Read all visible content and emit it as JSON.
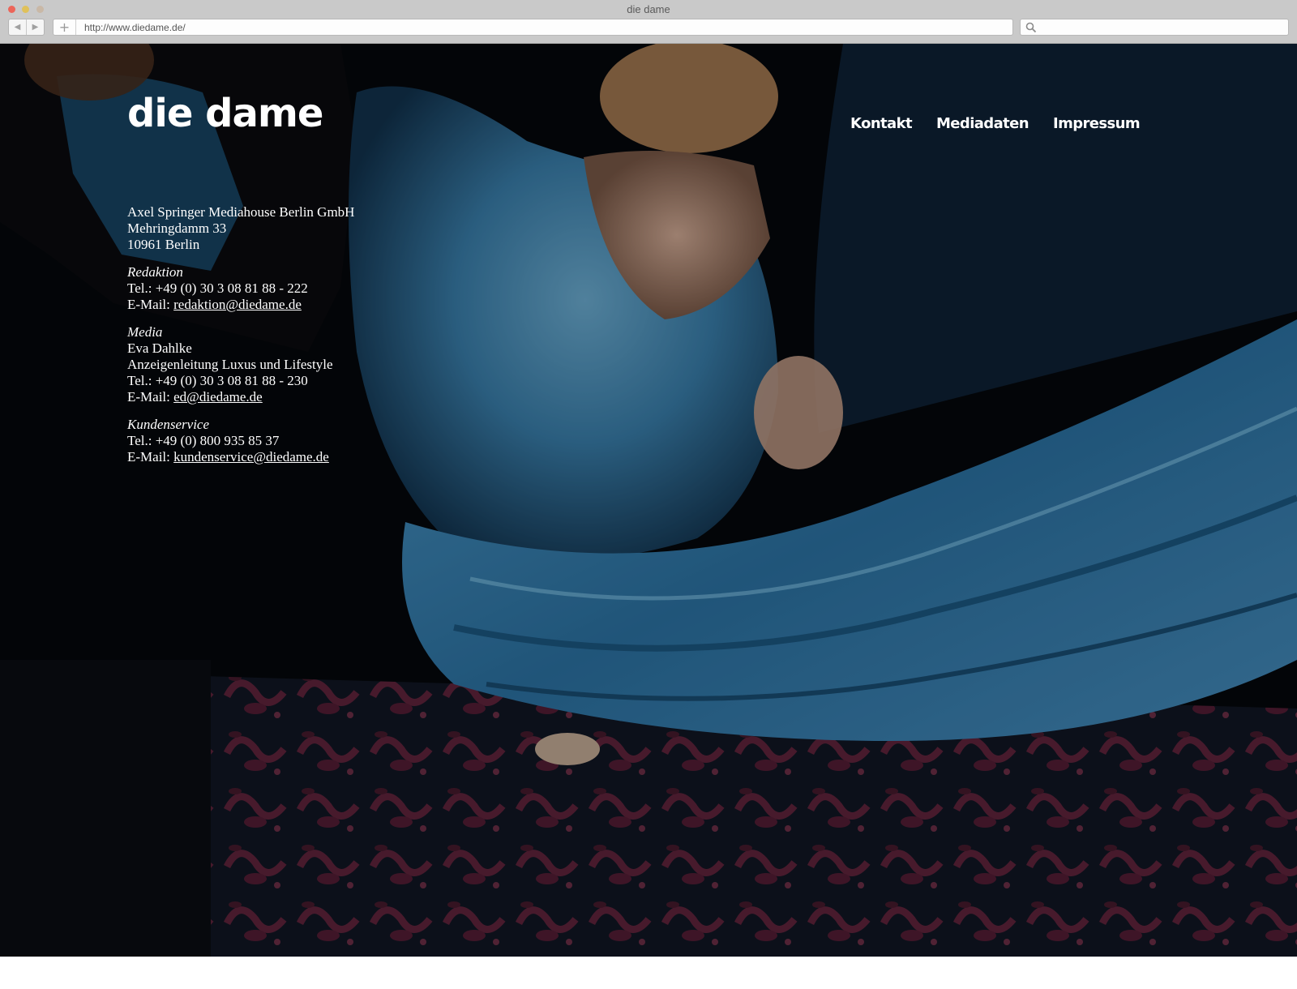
{
  "window": {
    "title": "die dame"
  },
  "browser": {
    "url": "http://www.diedame.de/",
    "back_icon": "◀",
    "forward_icon": "▶",
    "new_tab_icon": "+"
  },
  "site": {
    "logo": "die dame",
    "nav": [
      "Kontakt",
      "Mediadaten",
      "Impressum"
    ]
  },
  "contact": {
    "address": [
      "Axel Springer Mediahouse Berlin GmbH",
      "Mehringdamm 33",
      "10961 Berlin"
    ],
    "redaktion": {
      "heading": "Redaktion",
      "tel": "Tel.: +49 (0) 30 3 08 81 88 - 222",
      "email_prefix": "E-Mail: ",
      "email": "redaktion@diedame.de"
    },
    "media": {
      "heading": "Media",
      "name": "Eva Dahlke",
      "role": "Anzeigenleitung Luxus und Lifestyle",
      "tel": "Tel.: +49 (0) 30 3 08 81 88 - 230",
      "email_prefix": "E-Mail: ",
      "email": "ed@diedame.de"
    },
    "kundenservice": {
      "heading": "Kundenservice",
      "tel": "Tel.: +49 (0) 800 935 85 37",
      "email_prefix": "E-Mail: ",
      "email": "kundenservice@diedame.de"
    }
  },
  "colors": {
    "chrome": "#c9c9c9",
    "page_bg": "#05080c",
    "dress_blue": "#3f86b4",
    "carpet_red": "#7a2b4a",
    "text": "#ffffff"
  }
}
